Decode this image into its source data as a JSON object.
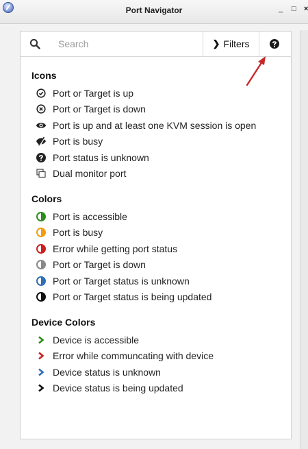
{
  "window": {
    "title": "Port Navigator",
    "minimize": "_",
    "maximize": "□",
    "close": "×"
  },
  "search": {
    "placeholder": "Search",
    "value": ""
  },
  "toolbar": {
    "filters_label": "Filters",
    "filters_chevron": "❯"
  },
  "colors": {
    "green": "#2e8b1e",
    "orange": "#f39c12",
    "red": "#cc1f1f",
    "gray": "#888888",
    "blue": "#2f6fb3",
    "black": "#111111",
    "arrow": "#c62828"
  },
  "sections": {
    "icons": {
      "title": "Icons",
      "items": [
        {
          "label": "Port or Target is up",
          "icon": "check-circle-icon"
        },
        {
          "label": "Port or Target is down",
          "icon": "x-circle-icon"
        },
        {
          "label": "Port is up and at least one KVM session is open",
          "icon": "eye-icon"
        },
        {
          "label": "Port is busy",
          "icon": "eye-slash-icon"
        },
        {
          "label": "Port status is unknown",
          "icon": "question-circle-icon"
        },
        {
          "label": "Dual monitor port",
          "icon": "dual-monitor-icon"
        }
      ]
    },
    "colors": {
      "title": "Colors",
      "items": [
        {
          "label": "Port is accessible",
          "icon": "half-circle-green-icon",
          "color": "#2e8b1e"
        },
        {
          "label": "Port is busy",
          "icon": "half-circle-orange-icon",
          "color": "#f39c12"
        },
        {
          "label": "Error while getting port status",
          "icon": "half-circle-red-icon",
          "color": "#cc1f1f"
        },
        {
          "label": "Port or Target is down",
          "icon": "half-circle-gray-icon",
          "color": "#888888"
        },
        {
          "label": "Port or Target status is unknown",
          "icon": "half-circle-blue-icon",
          "color": "#2f6fb3"
        },
        {
          "label": "Port or Target status is being updated",
          "icon": "half-circle-black-icon",
          "color": "#111111"
        }
      ]
    },
    "device_colors": {
      "title": "Device Colors",
      "items": [
        {
          "label": "Device is accessible",
          "icon": "chevron-right-green-icon",
          "color": "#2e8b1e"
        },
        {
          "label": "Error while communcating with device",
          "icon": "chevron-right-red-icon",
          "color": "#cc1f1f"
        },
        {
          "label": "Device status is unknown",
          "icon": "chevron-right-blue-icon",
          "color": "#2f6fb3"
        },
        {
          "label": "Device status is being updated",
          "icon": "chevron-right-black-icon",
          "color": "#111111"
        }
      ]
    }
  }
}
